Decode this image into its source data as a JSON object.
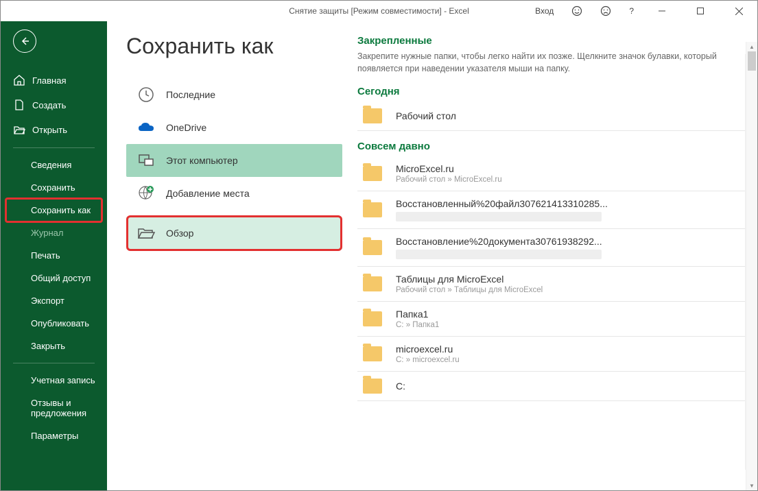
{
  "title": "Снятие защиты  [Режим совместимости]  -  Excel",
  "signin": "Вход",
  "page_header": "Сохранить как",
  "nav": {
    "home": "Главная",
    "new": "Создать",
    "open": "Открыть",
    "info": "Сведения",
    "save": "Сохранить",
    "saveas": "Сохранить как",
    "history": "Журнал",
    "print": "Печать",
    "share": "Общий доступ",
    "export": "Экспорт",
    "publish": "Опубликовать",
    "close": "Закрыть",
    "account": "Учетная запись",
    "feedback": "Отзывы и предложения",
    "options": "Параметры"
  },
  "locations": {
    "recent": "Последние",
    "onedrive": "OneDrive",
    "thispc": "Этот компьютер",
    "addplace": "Добавление места",
    "browse": "Обзор"
  },
  "pinned": {
    "head": "Закрепленные",
    "desc": "Закрепите нужные папки, чтобы легко найти их позже. Щелкните значок булавки, который появляется при наведении указателя мыши на папку."
  },
  "sections": {
    "today": "Сегодня",
    "older": "Совсем давно"
  },
  "folders": {
    "desktop": {
      "name": "Рабочий стол"
    },
    "f1": {
      "name": "MicroExcel.ru",
      "path": "Рабочий стол » MicroExcel.ru"
    },
    "f2": {
      "name": "Восстановленный%20файл307621413310285..."
    },
    "f3": {
      "name": "Восстановление%20документа30761938292..."
    },
    "f4": {
      "name": "Таблицы для MicroExcel",
      "path": "Рабочий стол » Таблицы для MicroExcel"
    },
    "f5": {
      "name": "Папка1",
      "path": "C: » Папка1"
    },
    "f6": {
      "name": "microexcel.ru",
      "path": "C: » microexcel.ru"
    },
    "f7": {
      "name": "C:"
    }
  }
}
